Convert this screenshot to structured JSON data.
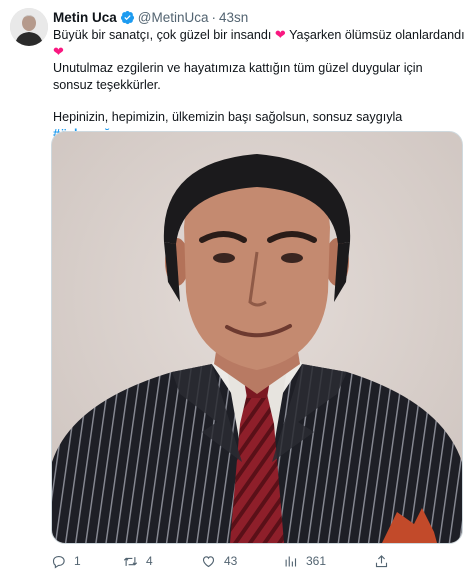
{
  "tweet": {
    "author_name": "Metin Uca",
    "handle": "@MetinUca",
    "separator": "·",
    "time": "43sn",
    "para1_text": "Büyük bir sanatçı, çok güzel bir insandı",
    "para1_text2": "Yaşarken ölümsüz olanlardandı",
    "heart": "❤",
    "para2": "Unutulmaz ezgilerin ve hayatımıza kattığın tüm güzel duygular için sonsuz teşekkürler.",
    "para3_text": "Hepinizin, hepimizin, ülkemizin başı sağolsun, sonsuz saygıyla",
    "hashtag": "#özkanuğur"
  },
  "actions": {
    "reply_count": "1",
    "retweet_count": "4",
    "like_count": "43",
    "views_count": "361"
  },
  "colors": {
    "verified": "#1d9bf0",
    "heart": "#f91880",
    "hashtag": "#1d9bf0",
    "muted": "#536471"
  },
  "icons": [
    "verified-badge-icon",
    "reply-icon",
    "retweet-icon",
    "like-icon",
    "views-icon",
    "share-icon"
  ]
}
